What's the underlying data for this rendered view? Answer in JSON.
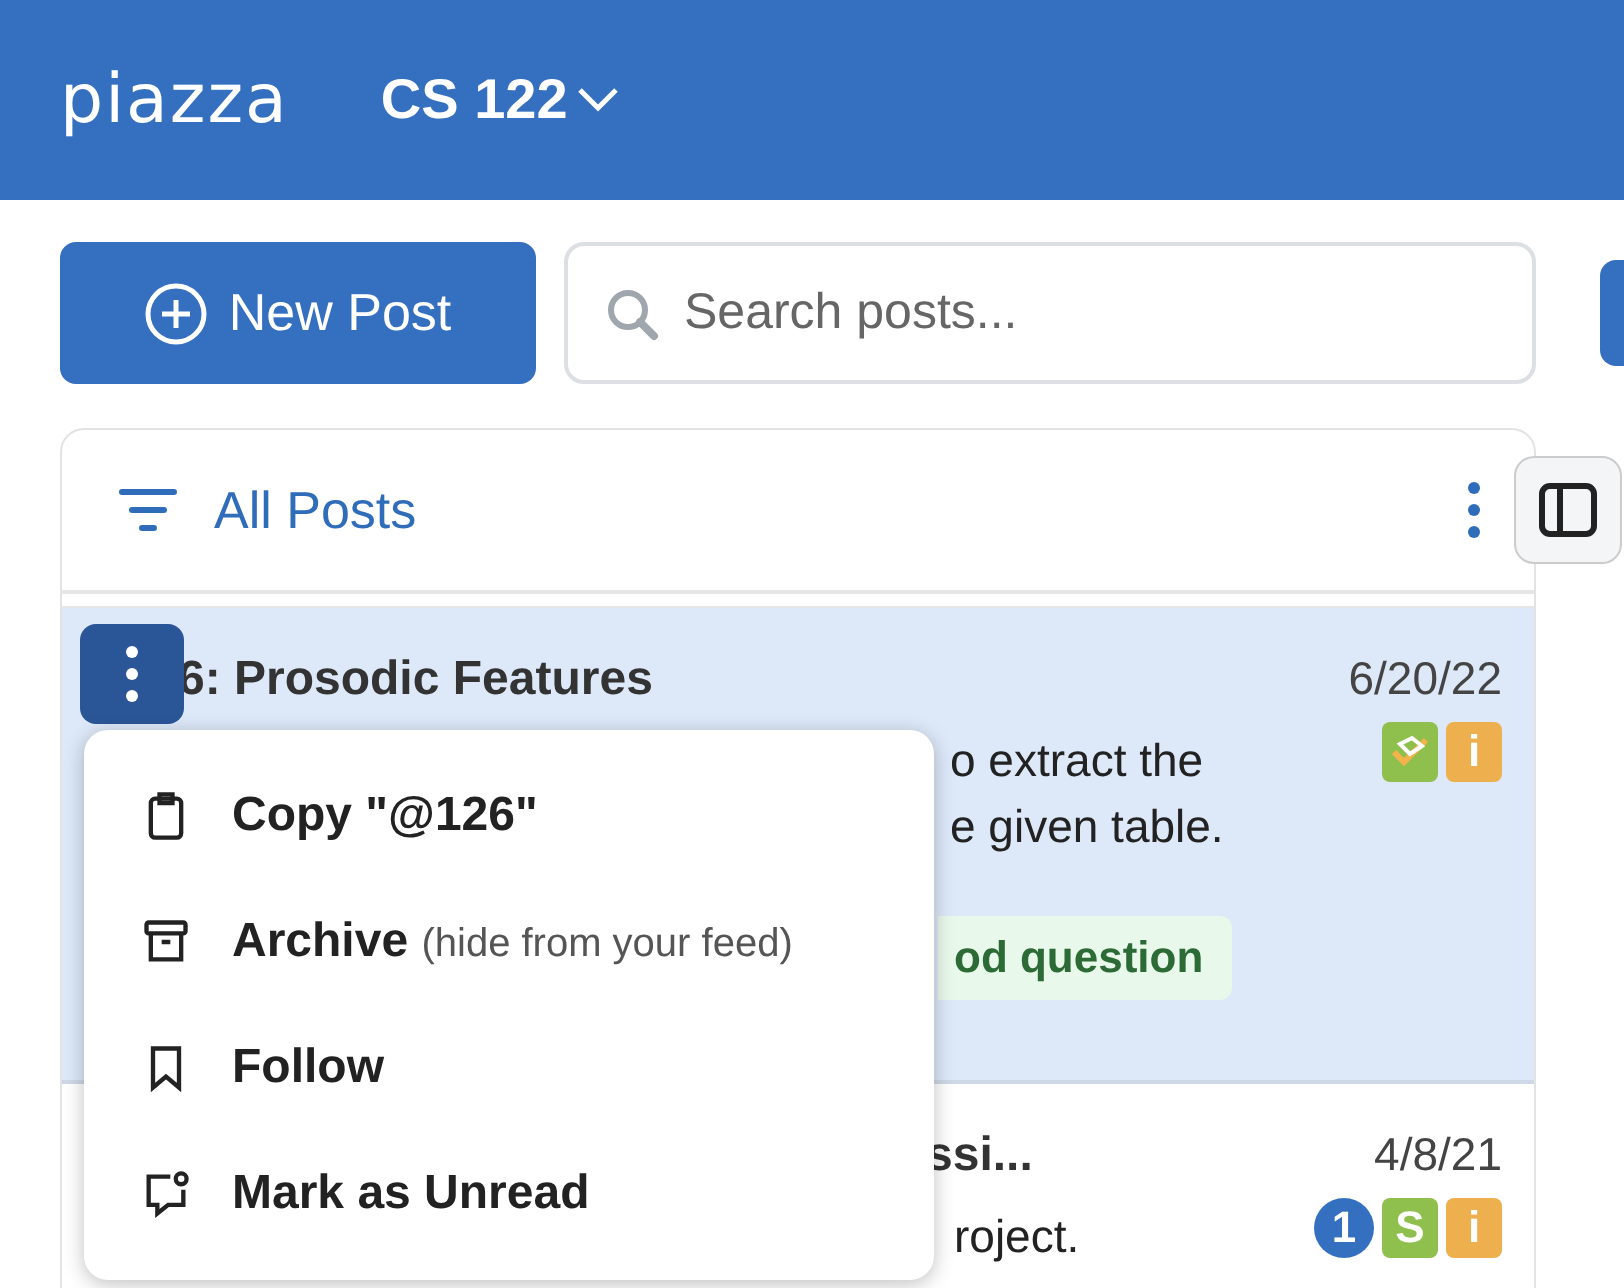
{
  "header": {
    "logo": "piazza",
    "course": "CS 122"
  },
  "toolbar": {
    "new_post": "New Post",
    "search": {
      "placeholder": "Search posts..."
    }
  },
  "feed": {
    "title": "All Posts",
    "posts": [
      {
        "title": "6: Prosodic Features",
        "date": "6/20/22",
        "lines": [
          "o extract the",
          "e given table."
        ],
        "tag": "od question",
        "selected": true,
        "badges": [
          {
            "kind": "resolved"
          },
          {
            "kind": "instructor",
            "text": "i"
          }
        ]
      },
      {
        "title": "ssi...",
        "date": "4/8/21",
        "lines": [
          "roject."
        ],
        "selected": false,
        "badges": [
          {
            "kind": "count",
            "text": "1"
          },
          {
            "kind": "student",
            "text": "S"
          },
          {
            "kind": "instructor",
            "text": "i"
          }
        ]
      }
    ]
  },
  "menu": {
    "items": [
      {
        "kind": "clipboard",
        "label": "Copy \"@126\""
      },
      {
        "kind": "archive",
        "label": "Archive",
        "note": "(hide from your feed)"
      },
      {
        "kind": "bookmark",
        "label": "Follow"
      },
      {
        "kind": "unread",
        "label": "Mark as Unread"
      }
    ]
  }
}
